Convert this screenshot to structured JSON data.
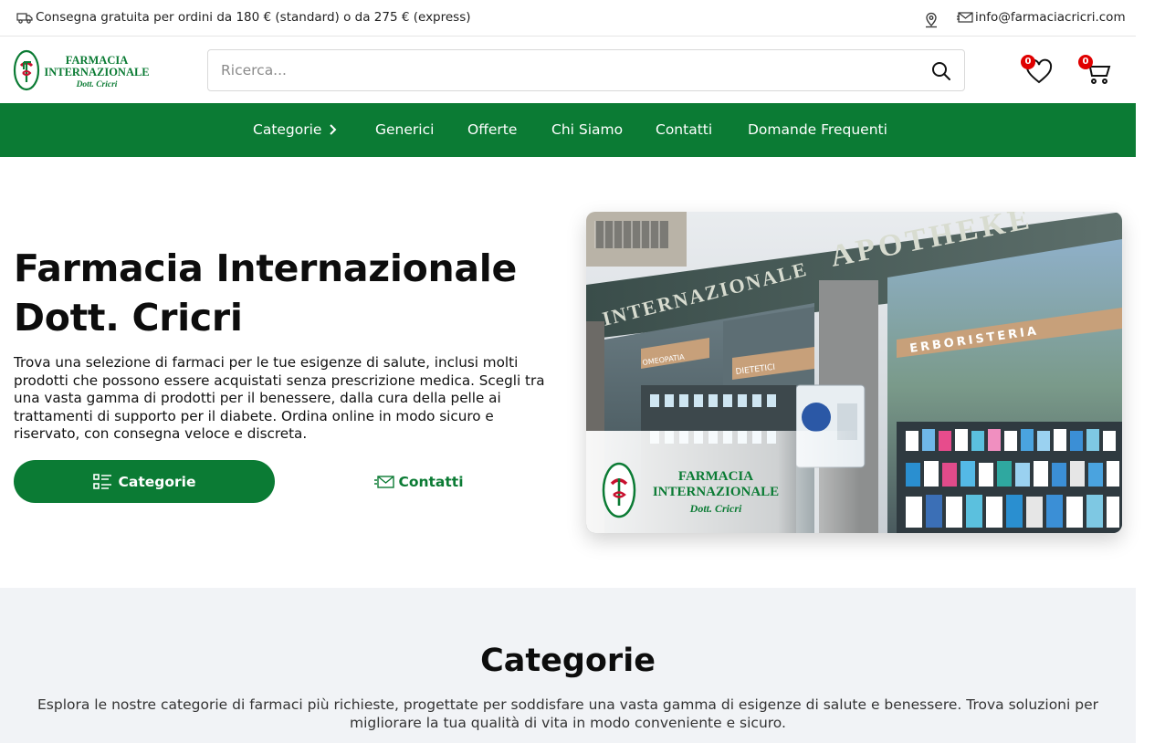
{
  "topbar": {
    "shipping_text": "Consegna gratuita per ordini da 180 € (standard) o da 275 € (express)",
    "email": "info@farmaciacricri.com"
  },
  "brand": {
    "line1": "FARMACIA",
    "line2": "INTERNAZIONALE",
    "line3": "Dott. Cricri",
    "green": "#0b7b34",
    "red": "#c8102e"
  },
  "search": {
    "placeholder": "Ricerca..."
  },
  "header": {
    "wishlist_count": "0",
    "cart_count": "0"
  },
  "nav": {
    "items": [
      {
        "label": "Categorie"
      },
      {
        "label": "Generici"
      },
      {
        "label": "Offerte"
      },
      {
        "label": "Chi Siamo"
      },
      {
        "label": "Contatti"
      },
      {
        "label": "Domande Frequenti"
      }
    ]
  },
  "hero": {
    "title_line1": "Farmacia Internazionale",
    "title_line2": "Dott. Cricri",
    "description": "Trova una selezione di farmaci per le tue esigenze di salute, inclusi molti prodotti che possono essere acquistati senza prescrizione medica. Scegli tra una vasta gamma di prodotti per il benessere, dalla cura della pelle ai trattamenti di supporto per il diabete. Ordina online in modo sicuro e riservato, con consegna veloce e discreta.",
    "primary_button": "Categorie",
    "secondary_button": "Contatti",
    "photo": {
      "sign_apotheke": "APOTHEKE",
      "sign_internazionale": "INTERNAZIONALE",
      "sign_dietetici": "DIETETICI",
      "sign_omeopatia": "OMEOPATIA",
      "sign_erboristeria": "ERBORISTERIA"
    }
  },
  "categories_section": {
    "title": "Categorie",
    "description": "Esplora le nostre categorie di farmaci più richieste, progettate per soddisfare una vasta gamma di esigenze di salute e benessere. Trova soluzioni per migliorare la tua qualità di vita in modo conveniente e sicuro."
  }
}
